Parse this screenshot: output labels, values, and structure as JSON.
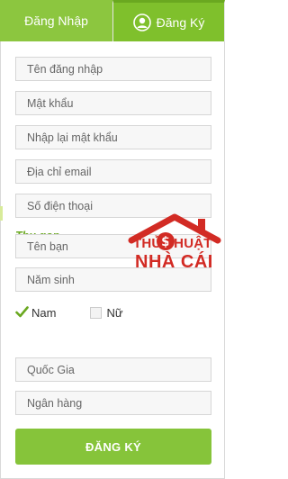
{
  "tabs": {
    "login_label": "Đăng Nhập",
    "register_label": "Đăng Ký"
  },
  "form": {
    "username_placeholder": "Tên đăng nhập",
    "password_placeholder": "Mật khẩu",
    "confirm_password_placeholder": "Nhập lại mật khẩu",
    "email_placeholder": "Địa chỉ email",
    "phone_placeholder": "Số điện thoại",
    "collapse_label": "Thu gọn",
    "name_placeholder": "Tên bạn",
    "birth_year_placeholder": "Năm sinh",
    "gender_male_label": "Nam",
    "gender_male_checked": true,
    "gender_female_label": "Nữ",
    "gender_female_checked": false,
    "country_placeholder": "Quốc Gia",
    "bank_placeholder": "Ngân hàng",
    "submit_label": "ĐĂNG KÝ"
  },
  "watermark": {
    "line1": "THỦ THUẬT",
    "line2": "NHÀ CÁI"
  },
  "colors": {
    "accent_green": "#8cc63f",
    "link_green": "#6aa820",
    "watermark_red": "#d22b24"
  }
}
